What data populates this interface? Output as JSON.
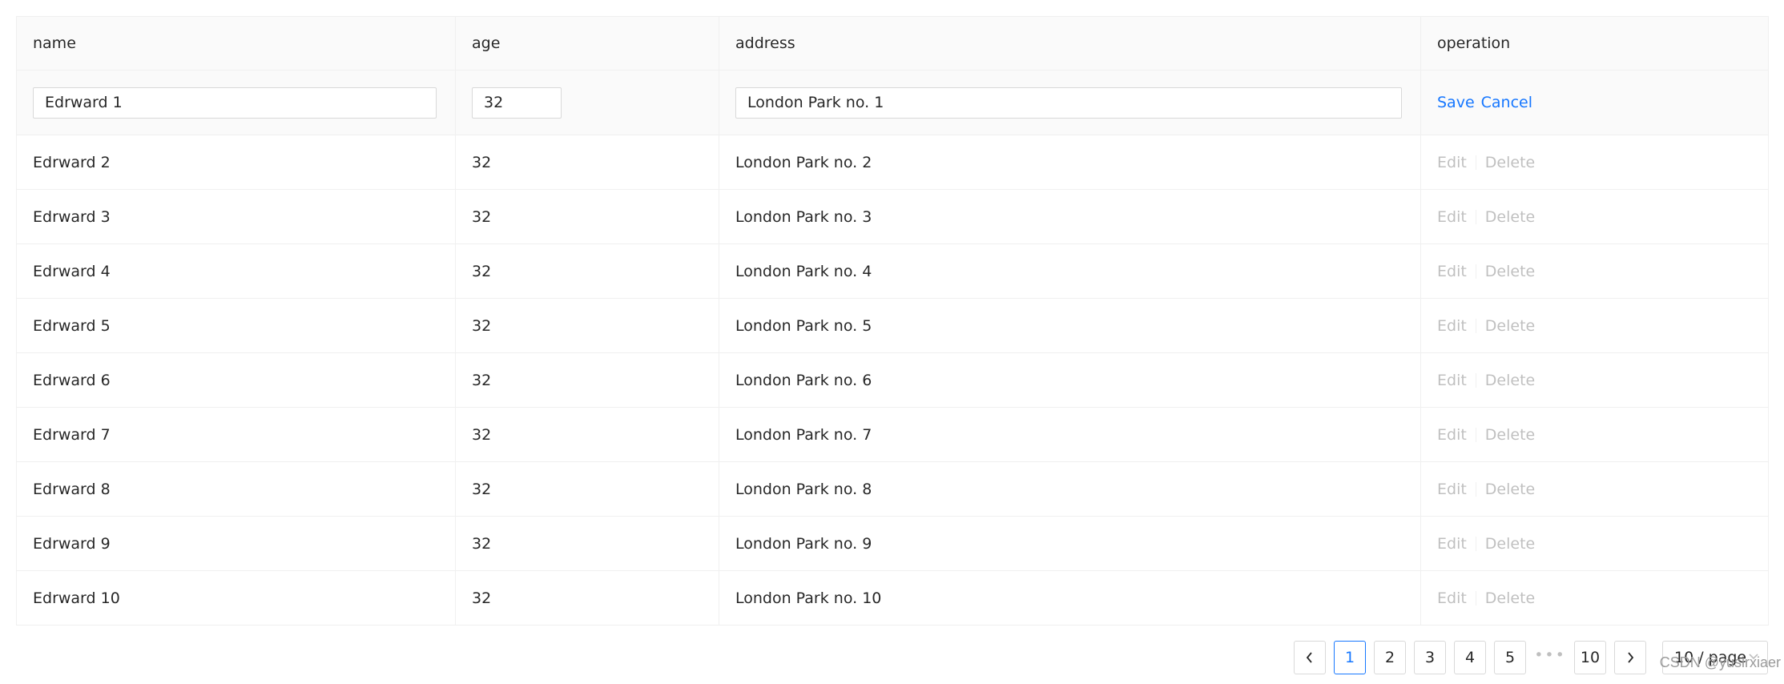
{
  "table": {
    "columns": [
      "name",
      "age",
      "address",
      "operation"
    ],
    "editing_row": {
      "name": "Edrward 1",
      "age": "32",
      "address": "London Park no. 1",
      "save_label": "Save",
      "cancel_label": "Cancel"
    },
    "rows": [
      {
        "name": "Edrward 2",
        "age": "32",
        "address": "London Park no. 2"
      },
      {
        "name": "Edrward 3",
        "age": "32",
        "address": "London Park no. 3"
      },
      {
        "name": "Edrward 4",
        "age": "32",
        "address": "London Park no. 4"
      },
      {
        "name": "Edrward 5",
        "age": "32",
        "address": "London Park no. 5"
      },
      {
        "name": "Edrward 6",
        "age": "32",
        "address": "London Park no. 6"
      },
      {
        "name": "Edrward 7",
        "age": "32",
        "address": "London Park no. 7"
      },
      {
        "name": "Edrward 8",
        "age": "32",
        "address": "London Park no. 8"
      },
      {
        "name": "Edrward 9",
        "age": "32",
        "address": "London Park no. 9"
      },
      {
        "name": "Edrward 10",
        "age": "32",
        "address": "London Park no. 10"
      }
    ],
    "row_actions": {
      "edit_label": "Edit",
      "delete_label": "Delete"
    }
  },
  "pagination": {
    "prev_icon": "chevron-left-icon",
    "next_icon": "chevron-right-icon",
    "pages": [
      "1",
      "2",
      "3",
      "4",
      "5"
    ],
    "current_page": "1",
    "ellipsis": "•••",
    "last_page": "10",
    "page_size_label": "10 / page",
    "page_size_icon": "chevron-down-icon"
  },
  "watermark": "CSDN @yusirxiaer",
  "colors": {
    "accent": "#1677ff",
    "disabled_text": "#bfbfbf",
    "header_bg": "#fafafa",
    "border": "#f0f0f0"
  }
}
